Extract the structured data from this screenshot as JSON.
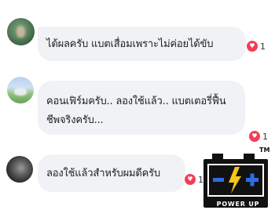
{
  "comments": [
    {
      "lines": [
        "ได้ผลครับ แบตเสื่อมเพราะไม่ค่อยได้ขับ"
      ],
      "reaction": {
        "icon": "heart-icon",
        "count": "1"
      }
    },
    {
      "lines": [
        "คอนเฟิร์มครับ.. ลองใช้แล้ว.. แบตเตอรี่ฟื้น",
        "ชีพจริงครับ..."
      ],
      "reaction": {
        "icon": "heart-icon",
        "count": "1"
      }
    },
    {
      "lines": [
        "ลองใช้แล้วสำหรับผมดีครับ"
      ],
      "reaction": {
        "icon": "heart-icon",
        "count": "1"
      }
    }
  ],
  "logo": {
    "text": "POWER UP",
    "trademark": "TM",
    "minus_symbol": "−",
    "plus_symbol": "+",
    "colors": {
      "body": "#111111",
      "accent": "#2e6be6",
      "bolt": "#f5c518"
    }
  },
  "colors": {
    "bubble": "#f0f2f5",
    "heart": "#f33e58",
    "text": "#1c1e21"
  }
}
